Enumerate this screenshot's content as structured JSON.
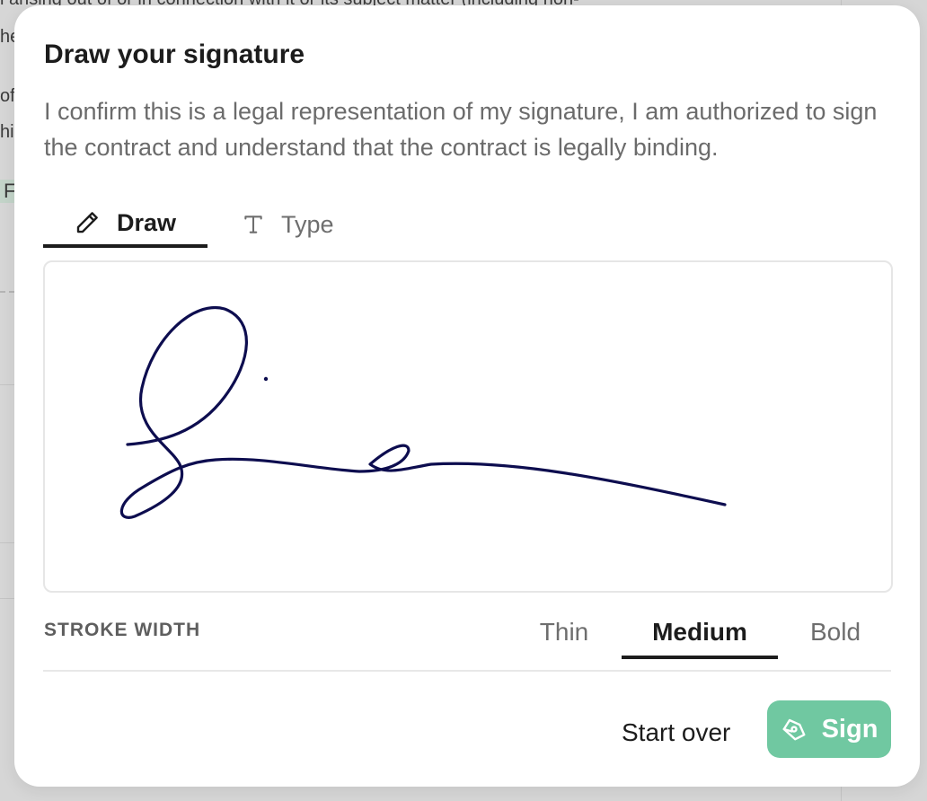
{
  "background": {
    "line1": "l arising out of or in connection with it or its subject matter (including non-",
    "line2": "he",
    "line3": "of",
    "line4": "his",
    "tag": "F"
  },
  "modal": {
    "title": "Draw your signature",
    "description": "I confirm this is a legal representation of my signature, I am authorized to sign the contract and understand that the contract is legally binding.",
    "tabs": [
      {
        "label": "Draw",
        "icon": "pencil-icon",
        "active": true
      },
      {
        "label": "Type",
        "icon": "text-type-icon",
        "active": false
      }
    ],
    "canvas": {
      "ink_color": "#0d0d4f"
    },
    "stroke_width": {
      "label": "STROKE WIDTH",
      "options": [
        "Thin",
        "Medium",
        "Bold"
      ],
      "selected": "Medium"
    },
    "actions": {
      "start_over_label": "Start over",
      "sign_label": "Sign",
      "sign_icon": "signature-pen-icon",
      "sign_color": "#70c8a1"
    }
  }
}
